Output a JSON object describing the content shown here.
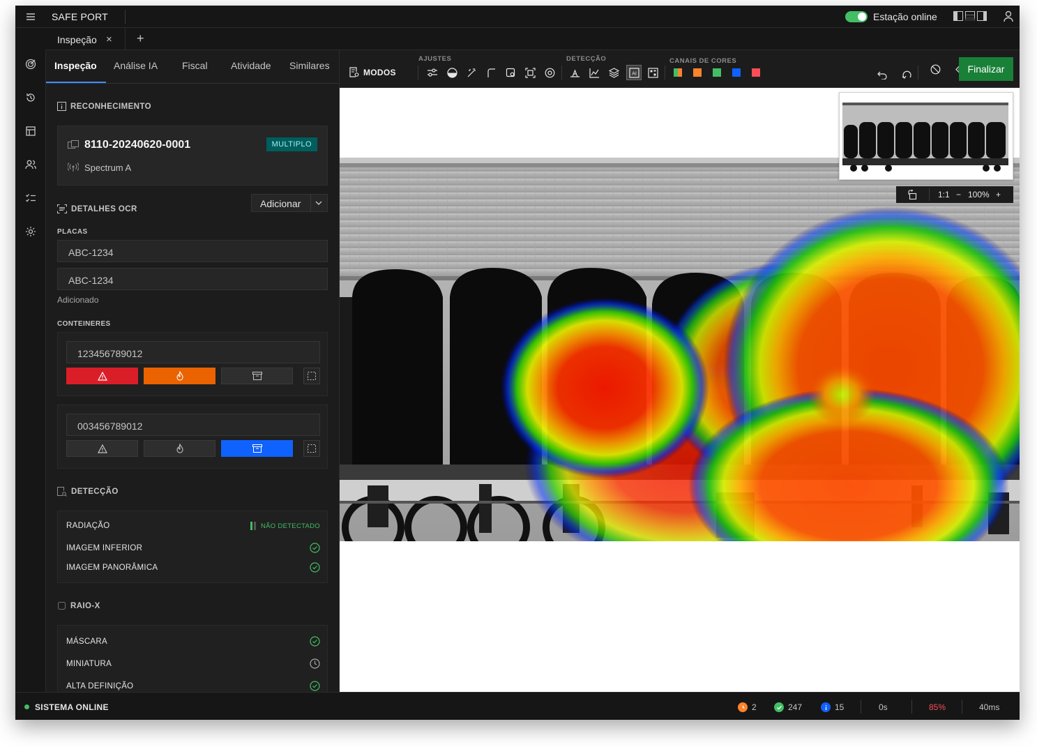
{
  "app": {
    "title": "SAFE PORT",
    "station_status": "Estação online"
  },
  "doc_tabs": {
    "active_label": "Inspeção",
    "close_glyph": "×",
    "add_glyph": "+"
  },
  "panel_tabs": [
    {
      "label": "Inspeção",
      "active": true
    },
    {
      "label": "Análise IA",
      "active": false
    },
    {
      "label": "Fiscal",
      "active": false
    },
    {
      "label": "Atividade",
      "active": false
    },
    {
      "label": "Similares",
      "active": false
    }
  ],
  "recognition": {
    "heading": "RECONHECIMENTO",
    "id": "8110-20240620-0001",
    "badge": "MULTIPLO",
    "scanner": "Spectrum A"
  },
  "ocr": {
    "heading": "DETALHES OCR",
    "add_button": "Adicionar",
    "plates_label": "PLACAS",
    "plates": [
      "ABC-1234",
      "ABC-1234"
    ],
    "added_helper": "Adicionado",
    "containers_label": "CONTEINERES",
    "containers": [
      {
        "number": "123456789012",
        "selected_tag": "alert+fire"
      },
      {
        "number": "003456789012",
        "selected_tag": "archive"
      }
    ]
  },
  "detection": {
    "heading": "DETECÇÃO",
    "radiation_label": "RADIAÇÃO",
    "radiation_status": "NÃO DETECTADO",
    "items": [
      {
        "label": "IMAGEM INFERIOR",
        "status": "ok"
      },
      {
        "label": "IMAGEM PANORÂMICA",
        "status": "ok"
      }
    ]
  },
  "xray": {
    "heading": "RAIO-X",
    "items": [
      {
        "label": "MÁSCARA",
        "status": "ok"
      },
      {
        "label": "MINIATURA",
        "status": "pending"
      },
      {
        "label": "ALTA DEFINIÇÃO",
        "status": "ok"
      }
    ]
  },
  "toolbar": {
    "modes_label": "MODOS",
    "group_adjust": "AJUSTES",
    "group_detection": "DETECÇÃO",
    "group_channels": "CANAIS DE CORES",
    "finish_button": "Finalizar",
    "channel_colors": [
      "#c8a23c",
      "#ff832b",
      "#42be65",
      "#0f62fe",
      "#fa4d56"
    ]
  },
  "viewer": {
    "ratio_label": "1:1",
    "zoom_minus": "−",
    "zoom_level": "100%",
    "zoom_plus": "+"
  },
  "status_bar": {
    "system_status": "SISTEMA ONLINE",
    "pending_count": "2",
    "done_count": "247",
    "info_count": "15",
    "time": "0s",
    "usage": "85%",
    "latency": "40ms"
  },
  "colors": {
    "accent_green": "#42be65",
    "finish_green": "#198038",
    "badge_teal": "#005d5d",
    "tag_red": "#da1e28",
    "tag_orange": "#eb6200",
    "tag_blue": "#0f62fe",
    "usage_red": "#fa4d56"
  }
}
